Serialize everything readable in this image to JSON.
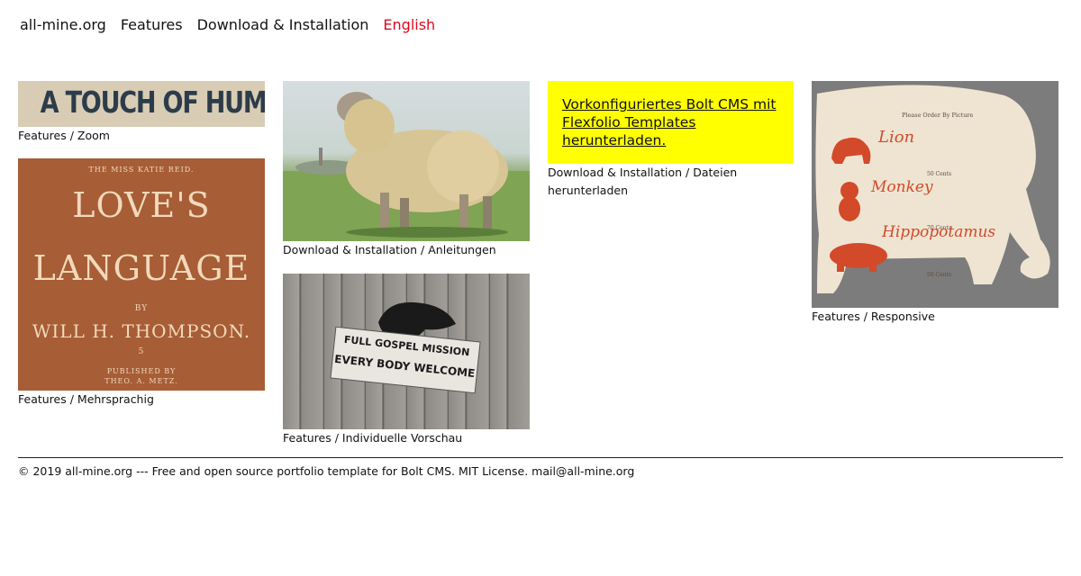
{
  "nav": {
    "site": "all-mine.org",
    "features": "Features",
    "download": "Download & Installation",
    "language": "English",
    "language_color": "#e0081d"
  },
  "tiles": [
    {
      "caption": "Features / Zoom",
      "image_text": "A TOUCH OF HUMANITY."
    },
    {
      "caption": "Features / Mehrsprachig",
      "image_text": {
        "top": "THE MISS KATIE REID.",
        "title1": "LOVE'S",
        "title2": "LANGUAGE",
        "by": "BY",
        "author": "WILL H. THOMPSON.",
        "number": "5",
        "published_by": "PUBLISHED BY",
        "publisher": "THEO. A. METZ."
      }
    },
    {
      "caption": "Download & Installation / Anleitungen"
    },
    {
      "caption": "Features / Individuelle Vorschau",
      "image_text": {
        "line1": "FULL GOSPEL MISSION",
        "line2": "EVERY BODY WELCOME"
      }
    },
    {
      "caption": "Download & Installation / Dateien herunterladen",
      "card_text": "Vorkonfiguriertes Bolt CMS mit Flexfolio Templates herunterladen.",
      "card_color": "#ffff00"
    },
    {
      "caption": "Features / Responsive",
      "image_text": {
        "heading": "Please Order By Picture",
        "animals": [
          "Lion",
          "Monkey",
          "Hippopotamus"
        ],
        "prices": [
          "50 Cents",
          "70 Cents",
          "50 Cents"
        ]
      }
    }
  ],
  "footer": "© 2019 all-mine.org --- Free and open source portfolio template for Bolt CMS. MIT License. mail@all-mine.org"
}
